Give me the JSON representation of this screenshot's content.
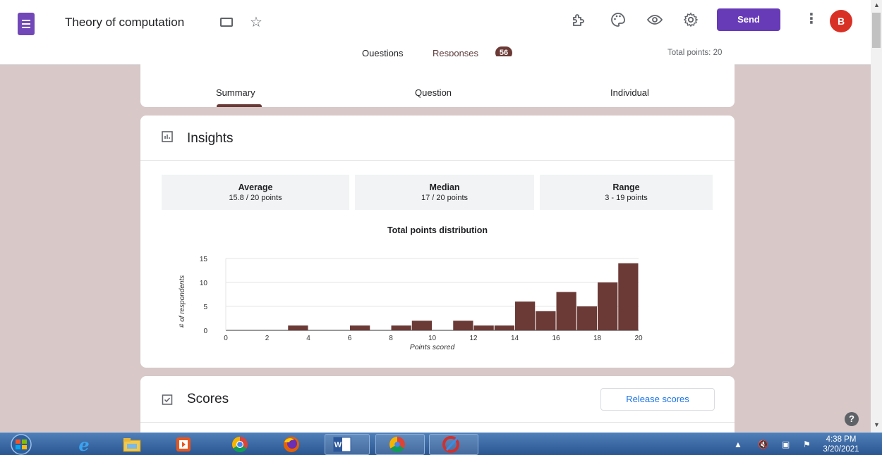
{
  "header": {
    "title": "Theory of computation",
    "send_label": "Send",
    "avatar_letter": "B",
    "tabs": {
      "questions": "Questions",
      "responses": "Responses",
      "responses_count": "56"
    },
    "total_points": "Total points: 20"
  },
  "summary_tabs": {
    "summary": "Summary",
    "question": "Question",
    "individual": "Individual"
  },
  "insights": {
    "title": "Insights",
    "stats": [
      {
        "label": "Average",
        "value": "15.8 / 20 points"
      },
      {
        "label": "Median",
        "value": "17 / 20 points"
      },
      {
        "label": "Range",
        "value": "3 - 19 points"
      }
    ]
  },
  "chart_data": {
    "type": "bar",
    "title": "Total points distribution",
    "xlabel": "Points scored",
    "ylabel": "# of respondents",
    "categories": [
      0,
      1,
      2,
      3,
      4,
      5,
      6,
      7,
      8,
      9,
      10,
      11,
      12,
      13,
      14,
      15,
      16,
      17,
      18,
      19
    ],
    "values": [
      0,
      0,
      0,
      1,
      0,
      0,
      1,
      0,
      1,
      2,
      0,
      2,
      1,
      1,
      6,
      4,
      8,
      5,
      10,
      14
    ],
    "xticks": [
      0,
      2,
      4,
      6,
      8,
      10,
      12,
      14,
      16,
      18,
      20
    ],
    "yticks": [
      0,
      5,
      10,
      15
    ],
    "xlim": [
      0,
      20
    ],
    "ylim": [
      0,
      15
    ],
    "bar_color": "#6b3a36",
    "grid": true
  },
  "scores": {
    "title": "Scores",
    "release_label": "Release scores"
  },
  "colors": {
    "accent": "#673ab7",
    "response_brown": "#6b3a36",
    "background": "#d8c8c8"
  },
  "taskbar": {
    "time": "4:38 PM",
    "date": "3/20/2021"
  }
}
